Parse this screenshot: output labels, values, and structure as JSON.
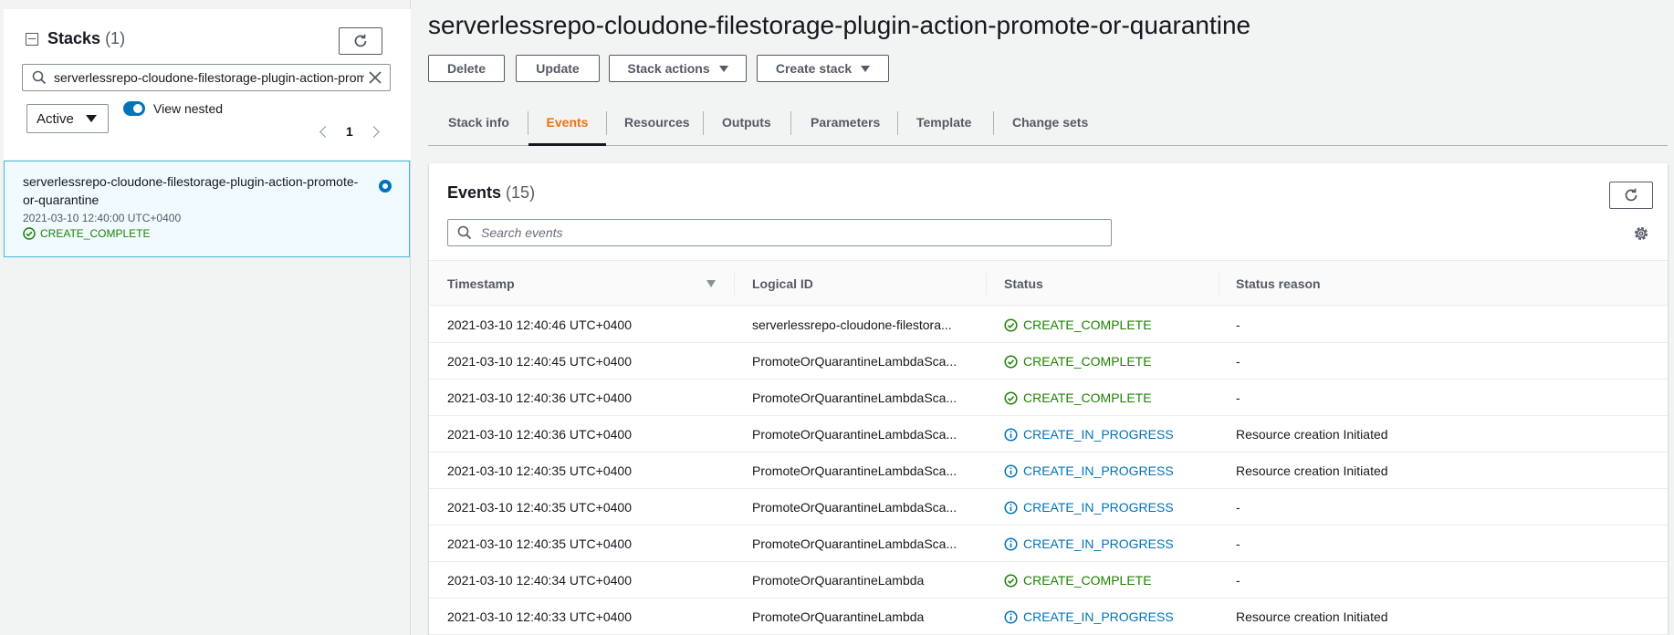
{
  "sidebar": {
    "title": "Stacks",
    "count": "(1)",
    "search_value": "serverlessrepo-cloudone-filestorage-plugin-action-promote-or-quarantine",
    "filter_value": "Active",
    "view_nested_label": "View nested",
    "page_number": "1",
    "stack": {
      "name": "serverlessrepo-cloudone-filestorage-plugin-action-promote-or-quarantine",
      "date": "2021-03-10 12:40:00 UTC+0400",
      "status": "CREATE_COMPLETE"
    }
  },
  "main": {
    "title": "serverlessrepo-cloudone-filestorage-plugin-action-promote-or-quarantine",
    "buttons": {
      "delete": "Delete",
      "update": "Update",
      "stack_actions": "Stack actions",
      "create_stack": "Create stack"
    },
    "tabs": [
      "Stack info",
      "Events",
      "Resources",
      "Outputs",
      "Parameters",
      "Template",
      "Change sets"
    ],
    "active_tab": "Events"
  },
  "events": {
    "title": "Events",
    "count": "(15)",
    "search_placeholder": "Search events",
    "columns": {
      "timestamp": "Timestamp",
      "logical_id": "Logical ID",
      "status": "Status",
      "status_reason": "Status reason"
    },
    "rows": [
      {
        "timestamp": "2021-03-10 12:40:46 UTC+0400",
        "logical_id": "serverlessrepo-cloudone-filestora...",
        "status": "CREATE_COMPLETE",
        "reason": "-"
      },
      {
        "timestamp": "2021-03-10 12:40:45 UTC+0400",
        "logical_id": "PromoteOrQuarantineLambdaSca...",
        "status": "CREATE_COMPLETE",
        "reason": "-"
      },
      {
        "timestamp": "2021-03-10 12:40:36 UTC+0400",
        "logical_id": "PromoteOrQuarantineLambdaSca...",
        "status": "CREATE_COMPLETE",
        "reason": "-"
      },
      {
        "timestamp": "2021-03-10 12:40:36 UTC+0400",
        "logical_id": "PromoteOrQuarantineLambdaSca...",
        "status": "CREATE_IN_PROGRESS",
        "reason": "Resource creation Initiated"
      },
      {
        "timestamp": "2021-03-10 12:40:35 UTC+0400",
        "logical_id": "PromoteOrQuarantineLambdaSca...",
        "status": "CREATE_IN_PROGRESS",
        "reason": "Resource creation Initiated"
      },
      {
        "timestamp": "2021-03-10 12:40:35 UTC+0400",
        "logical_id": "PromoteOrQuarantineLambdaSca...",
        "status": "CREATE_IN_PROGRESS",
        "reason": "-"
      },
      {
        "timestamp": "2021-03-10 12:40:35 UTC+0400",
        "logical_id": "PromoteOrQuarantineLambdaSca...",
        "status": "CREATE_IN_PROGRESS",
        "reason": "-"
      },
      {
        "timestamp": "2021-03-10 12:40:34 UTC+0400",
        "logical_id": "PromoteOrQuarantineLambda",
        "status": "CREATE_COMPLETE",
        "reason": "-"
      },
      {
        "timestamp": "2021-03-10 12:40:33 UTC+0400",
        "logical_id": "PromoteOrQuarantineLambda",
        "status": "CREATE_IN_PROGRESS",
        "reason": "Resource creation Initiated"
      }
    ]
  },
  "colors": {
    "complete": "#1d8102",
    "in_progress": "#0073bb",
    "active_tab": "#ec7211",
    "selected_card_border": "#44b9d6"
  },
  "icons": {
    "refresh": "refresh-icon",
    "search": "search-icon",
    "clear": "close-icon",
    "settings": "gear-icon",
    "complete": "check-circle-icon",
    "in_progress": "info-circle-icon"
  }
}
